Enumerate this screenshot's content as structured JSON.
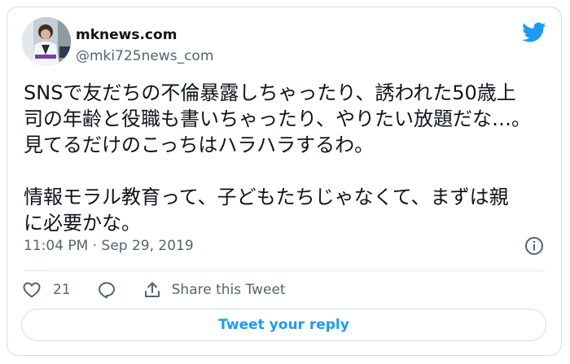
{
  "author": {
    "display_name": "mknews.com",
    "handle": "@mki725news_com"
  },
  "tweet": {
    "text": "SNSで友だちの不倫暴露しちゃったり、誘われた50歳上\n司の年齢と役職も書いちゃったり、やりたい放題だな…。\n見てるだけのこっちはハラハラするわ。\n\n情報モラル教育って、子どもたちじゃなくて、まずは親\nに必要かな。",
    "timestamp": "11:04 PM · Sep 29, 2019"
  },
  "actions": {
    "like_count": "21",
    "share_label": "Share this Tweet"
  },
  "reply_button": {
    "label": "Tweet your reply"
  },
  "colors": {
    "brand_blue": "#1d9bf0",
    "secondary_text": "#536471",
    "border": "#d4dde4"
  },
  "icons": {
    "brand": "twitter-bird-icon",
    "info": "info-icon",
    "like": "heart-icon",
    "reply": "speech-bubble-icon",
    "share": "share-arrow-icon"
  }
}
